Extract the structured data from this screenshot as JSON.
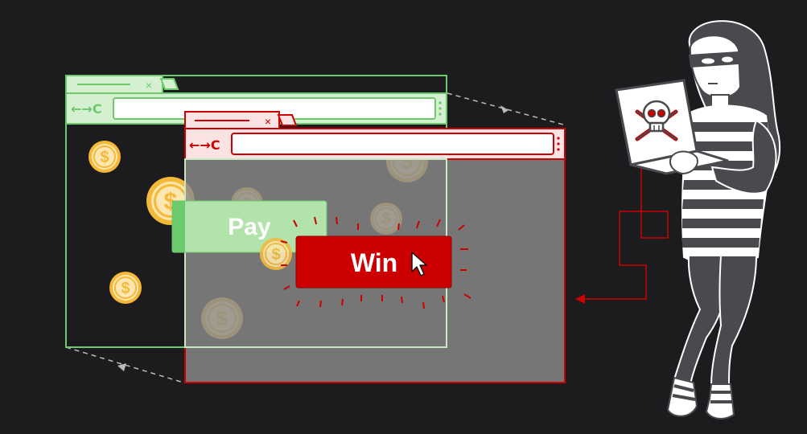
{
  "colors": {
    "background": "#1c1c1e",
    "legit_green": "#6cc96c",
    "legit_green_light": "#d4f0d0",
    "attacker_red": "#cc0000",
    "attacker_red_light": "#fbe3e3",
    "overlay_gray": "#8a8a8a",
    "coin_gold": "#f5b93a",
    "coin_light": "#fde7b0",
    "hacker_gray": "#4a4a4e"
  },
  "legit_window": {
    "tab_close_glyph": "×",
    "nav_glyphs": "←→C",
    "button_label": "Pay"
  },
  "attacker_window": {
    "tab_close_glyph": "×",
    "nav_glyphs": "←→C",
    "button_label": "Win"
  },
  "icons": {
    "coin": "dollar-coin-icon",
    "cursor": "mouse-pointer-icon",
    "skull": "skull-crossbones-icon"
  }
}
